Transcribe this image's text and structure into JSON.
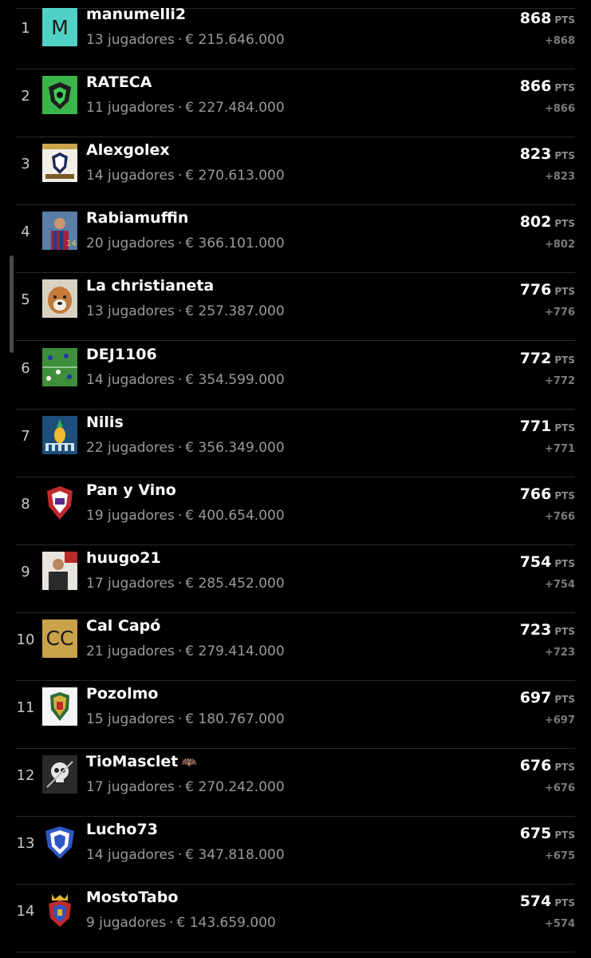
{
  "colors": {
    "background": "#000000",
    "divider": "#2a2a2a",
    "name": "#ffffff",
    "meta": "#9a9a9a",
    "delta": "#7a7a7a",
    "avatar_m": "#4fd1c5",
    "avatar_cc": "#c9a24a"
  },
  "ranking": [
    {
      "rank": "1",
      "name": "manumelli2",
      "players": "13 jugadores",
      "value": "€ 215.646.000",
      "points": "868",
      "pts_unit": "PTS",
      "delta": "+868",
      "avatar": {
        "type": "letter",
        "text": "M",
        "color": "#4fd1c5"
      }
    },
    {
      "rank": "2",
      "name": "RATECA",
      "players": "11 jugadores",
      "value": "€ 227.484.000",
      "points": "866",
      "pts_unit": "PTS",
      "delta": "+866",
      "avatar": {
        "type": "image",
        "icon": "green-shield-crest-icon"
      }
    },
    {
      "rank": "3",
      "name": "Alexgolex",
      "players": "14 jugadores",
      "value": "€ 270.613.000",
      "points": "823",
      "pts_unit": "PTS",
      "delta": "+823",
      "avatar": {
        "type": "image",
        "icon": "white-crest-icon"
      }
    },
    {
      "rank": "4",
      "name": "Rabiamuffin",
      "players": "20 jugadores",
      "value": "€ 366.101.000",
      "points": "802",
      "pts_unit": "PTS",
      "delta": "+802",
      "avatar": {
        "type": "image",
        "icon": "player-photo-icon"
      }
    },
    {
      "rank": "5",
      "name": "La christianeta",
      "players": "13 jugadores",
      "value": "€ 257.387.000",
      "points": "776",
      "pts_unit": "PTS",
      "delta": "+776",
      "avatar": {
        "type": "image",
        "icon": "dog-photo-icon"
      }
    },
    {
      "rank": "6",
      "name": "DEJ1106",
      "players": "14 jugadores",
      "value": "€ 354.599.000",
      "points": "772",
      "pts_unit": "PTS",
      "delta": "+772",
      "avatar": {
        "type": "image",
        "icon": "football-pitch-photo-icon"
      }
    },
    {
      "rank": "7",
      "name": "Nilis",
      "players": "22 jugadores",
      "value": "€ 356.349.000",
      "points": "771",
      "pts_unit": "PTS",
      "delta": "+771",
      "avatar": {
        "type": "image",
        "icon": "pineapple-art-icon"
      }
    },
    {
      "rank": "8",
      "name": "Pan y Vino",
      "players": "19 jugadores",
      "value": "€ 400.654.000",
      "points": "766",
      "pts_unit": "PTS",
      "delta": "+766",
      "avatar": {
        "type": "image",
        "icon": "red-shield-crest-icon"
      }
    },
    {
      "rank": "9",
      "name": "huugo21",
      "players": "17 jugadores",
      "value": "€ 285.452.000",
      "points": "754",
      "pts_unit": "PTS",
      "delta": "+754",
      "avatar": {
        "type": "image",
        "icon": "person-photo-icon"
      }
    },
    {
      "rank": "10",
      "name": "Cal Capó",
      "players": "21 jugadores",
      "value": "€ 279.414.000",
      "points": "723",
      "pts_unit": "PTS",
      "delta": "+723",
      "avatar": {
        "type": "letter",
        "text": "CC",
        "color": "#c9a24a"
      }
    },
    {
      "rank": "11",
      "name": "Pozolmo",
      "players": "15 jugadores",
      "value": "€ 180.767.000",
      "points": "697",
      "pts_unit": "PTS",
      "delta": "+697",
      "avatar": {
        "type": "image",
        "icon": "coat-of-arms-icon"
      }
    },
    {
      "rank": "12",
      "name": "TioMasclet",
      "name_suffix": "🦇",
      "players": "17 jugadores",
      "value": "€ 270.242.000",
      "points": "676",
      "pts_unit": "PTS",
      "delta": "+676",
      "avatar": {
        "type": "image",
        "icon": "skull-art-icon"
      }
    },
    {
      "rank": "13",
      "name": "Lucho73",
      "players": "14 jugadores",
      "value": "€ 347.818.000",
      "points": "675",
      "pts_unit": "PTS",
      "delta": "+675",
      "avatar": {
        "type": "image",
        "icon": "blue-shield-crest-icon"
      }
    },
    {
      "rank": "14",
      "name": "MostoTabo",
      "players": "9 jugadores",
      "value": "€ 143.659.000",
      "points": "574",
      "pts_unit": "PTS",
      "delta": "+574",
      "avatar": {
        "type": "image",
        "icon": "royal-crest-icon"
      }
    }
  ]
}
